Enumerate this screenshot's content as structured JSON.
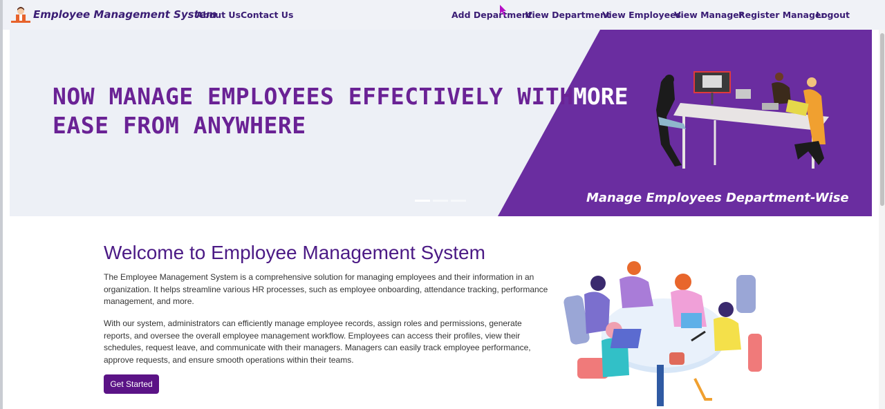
{
  "header": {
    "brand": "Employee Management System",
    "left_links": [
      "About Us",
      "Contact Us"
    ],
    "right_links": [
      "Add Department",
      "View Department",
      "View Employees",
      "View Manager",
      "Register Manager",
      "Logout"
    ]
  },
  "carousel": {
    "headline_line1": "NOW MANAGE EMPLOYEES EFFECTIVELY WITH",
    "headline_more": "MORE",
    "headline_line2": "EASE FROM ANYWHERE",
    "caption": "Manage Employees Department-Wise",
    "active_slide": 1,
    "slide_count": 3
  },
  "welcome": {
    "title": "Welcome to Employee Management System",
    "paragraph1": "The Employee Management System is a comprehensive solution for managing employees and their information in an organization. It helps streamline various HR processes, such as employee onboarding, attendance tracking, performance management, and more.",
    "paragraph2": "With our system, administrators can efficiently manage employee records, assign roles and permissions, generate reports, and oversee the overall employee management workflow. Employees can access their profiles, view their schedules, request leave, and communicate with their managers. Managers can easily track employee performance, approve requests, and ensure smooth operations within their teams.",
    "button": "Get Started"
  },
  "colors": {
    "brand_purple": "#6a2da0",
    "button_purple": "#5b1386",
    "title_purple": "#4b1a85"
  }
}
